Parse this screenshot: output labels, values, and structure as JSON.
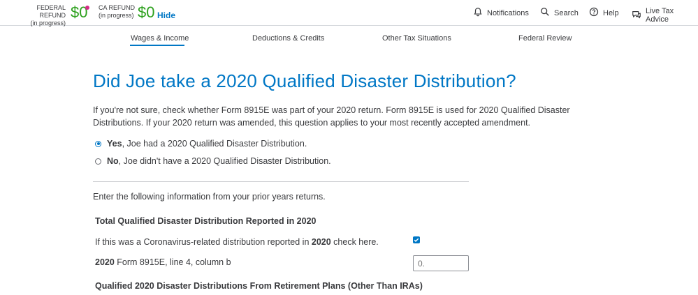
{
  "header": {
    "federal": {
      "label": "FEDERAL REFUND",
      "status": "(in progress)",
      "amount": "$0"
    },
    "state": {
      "label": "CA REFUND",
      "status": "(in progress)",
      "amount": "$0"
    },
    "hide_label": "Hide",
    "nav": {
      "notifications": "Notifications",
      "search": "Search",
      "help": "Help",
      "live_advice": "Live Tax Advice"
    },
    "colors": {
      "refund_green": "#2ca01c",
      "accent_blue": "#0077c5",
      "alert_pink": "#d52b88"
    }
  },
  "tabs": [
    {
      "label": "Wages & Income",
      "active": true
    },
    {
      "label": "Deductions & Credits",
      "active": false
    },
    {
      "label": "Other Tax Situations",
      "active": false
    },
    {
      "label": "Federal Review",
      "active": false
    }
  ],
  "main": {
    "title": "Did Joe take a 2020 Qualified Disaster Distribution?",
    "intro": "If you're not sure, check whether Form 8915E was part of your 2020 return. Form 8915E is used for 2020 Qualified Disaster Distributions. If your 2020 return was amended, this question applies to your most recently accepted amendment.",
    "options": [
      {
        "bold": "Yes",
        "text": ", Joe had a 2020 Qualified Disaster Distribution.",
        "selected": true
      },
      {
        "bold": "No",
        "text": ", Joe didn't have a 2020 Qualified Disaster Distribution.",
        "selected": false
      }
    ],
    "enter_text": "Enter the following information from your prior years returns.",
    "section1_heading": "Total Qualified Disaster Distribution Reported in 2020",
    "coronavirus_row": {
      "prefix": "If this was a Coronavirus-related distribution reported in ",
      "year": "2020",
      "suffix": " check here.",
      "checked": true
    },
    "form_row": {
      "year": "2020",
      "text": " Form 8915E, line 4, column b",
      "placeholder": "0."
    },
    "section2_heading": "Qualified 2020 Disaster Distributions From Retirement Plans (Other Than IRAs)"
  }
}
